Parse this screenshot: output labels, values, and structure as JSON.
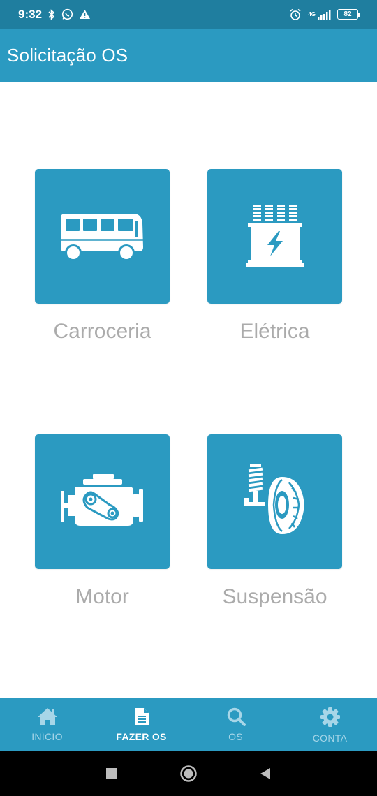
{
  "status_bar": {
    "time": "9:32",
    "network": "4G",
    "battery": "82",
    "icons": [
      "bluetooth-icon",
      "whatsapp-icon",
      "warning-icon",
      "alarm-icon",
      "signal-icon",
      "battery-icon"
    ]
  },
  "app_bar": {
    "title": "Solicitação OS"
  },
  "categories": [
    {
      "label": "Carroceria",
      "icon": "bus-icon"
    },
    {
      "label": "Elétrica",
      "icon": "transformer-icon"
    },
    {
      "label": "Motor",
      "icon": "engine-icon"
    },
    {
      "label": "Suspensão",
      "icon": "suspension-icon"
    }
  ],
  "bottom_nav": {
    "items": [
      {
        "label": "INÍCIO",
        "icon": "home-icon",
        "active": false
      },
      {
        "label": "FAZER OS",
        "icon": "document-icon",
        "active": true
      },
      {
        "label": "OS",
        "icon": "search-icon",
        "active": false
      },
      {
        "label": "CONTA",
        "icon": "gear-icon",
        "active": false
      }
    ]
  },
  "colors": {
    "primary": "#2b9ac1",
    "status_bar": "#1f7e9f",
    "label_gray": "#ababab",
    "nav_inactive": "#a7d6e8",
    "nav_active": "#ffffff"
  }
}
